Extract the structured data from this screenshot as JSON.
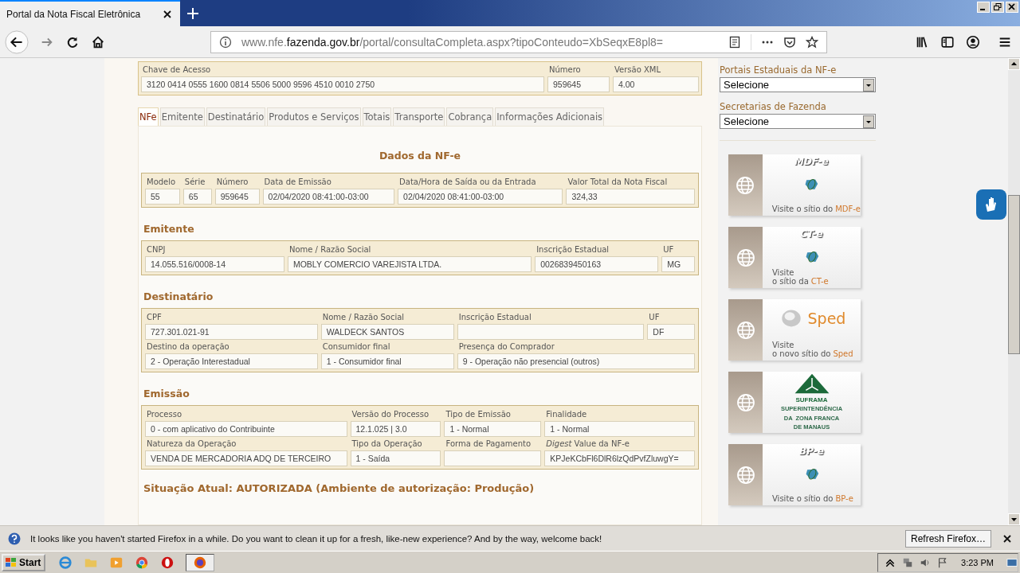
{
  "browser": {
    "tab_title": "Portal da Nota Fiscal Eletrônica",
    "url_prefix": "www.nfe.",
    "url_domain": "fazenda.gov.br",
    "url_path": "/portal/consultaCompleta.aspx?tipoConteudo=XbSeqxE8pl8="
  },
  "key_box": [
    {
      "label": "Chave de Acesso",
      "value": "3120 0414 0555 1600 0814 5506 5000 9596 4510 0010 2750"
    },
    {
      "label": "Número",
      "value": "959645"
    },
    {
      "label": "Versão XML",
      "value": "4.00"
    }
  ],
  "tabs": [
    {
      "label": "NFe",
      "selected": true
    },
    {
      "label": "Emitente",
      "selected": false
    },
    {
      "label": "Destinatário",
      "selected": false
    },
    {
      "label": "Produtos e Serviços",
      "selected": false
    },
    {
      "label": "Totais",
      "selected": false
    },
    {
      "label": "Transporte",
      "selected": false
    },
    {
      "label": "Cobrança",
      "selected": false
    },
    {
      "label": "Informações Adicionais",
      "selected": false
    }
  ],
  "panel_title": "Dados da NF-e",
  "sections": [
    {
      "rows": [
        [
          {
            "label": "Modelo",
            "value": "55"
          },
          {
            "label": "Série",
            "value": "65"
          },
          {
            "label": "Número",
            "value": "959645"
          },
          {
            "label": "Data de Emissão",
            "value": "02/04/2020 08:41:00-03:00"
          },
          {
            "label": "Data/Hora de Saída ou da Entrada",
            "value": "02/04/2020 08:41:00-03:00"
          },
          {
            "label": "Valor Total da Nota Fiscal",
            "value": "324,33"
          }
        ]
      ]
    },
    {
      "heading": "Emitente",
      "rows": [
        [
          {
            "label": "CNPJ",
            "value": "14.055.516/0008-14"
          },
          {
            "label": "Nome / Razão Social",
            "value": "MOBLY COMERCIO VAREJISTA LTDA."
          },
          {
            "label": "Inscrição Estadual",
            "value": "0026839450163"
          },
          {
            "label": "UF",
            "value": "MG"
          }
        ]
      ]
    },
    {
      "heading": "Destinatário",
      "rows": [
        [
          {
            "label": "CPF",
            "value": "727.301.021-91"
          },
          {
            "label": "Nome / Razão Social",
            "value": "WALDECK SANTOS"
          },
          {
            "label": "Inscrição Estadual"
          },
          {
            "label": "UF",
            "value": "DF"
          }
        ],
        [
          {
            "label": "Destino da operação",
            "value": "2 - Operação Interestadual"
          },
          {
            "label": "Consumidor final",
            "value": "1 - Consumidor final"
          },
          {
            "label": "Presença do Comprador",
            "value": "9 - Operação não presencial (outros)"
          }
        ]
      ]
    },
    {
      "heading": "Emissão",
      "rows": [
        [
          {
            "label": "Processo",
            "value": "0 - com aplicativo do Contribuinte"
          },
          {
            "label": "Versão do Processo",
            "value": "12.1.025 | 3.0"
          },
          {
            "label": "Tipo de Emissão",
            "value": "1 - Normal"
          },
          {
            "label": "Finalidade",
            "value": "1 - Normal"
          }
        ],
        [
          {
            "label": "Natureza da Operação",
            "value": "VENDA DE MERCADORIA ADQ DE TERCEIRO"
          },
          {
            "label": "Tipo da Operação",
            "value": "1 - Saída"
          },
          {
            "label": "Forma de Pagamento"
          },
          {
            "label": "*Digest* Value da NF-e",
            "value": "KPJeKCbFl6DlR6lzQdPvfZluwgY="
          }
        ]
      ]
    }
  ],
  "status_line": "Situação Atual: AUTORIZADA (Ambiente de autorização: Produção)",
  "sidebar": {
    "selects": [
      {
        "label": "Portais Estaduais da NF-e",
        "value": "Selecione"
      },
      {
        "label": "Secretarias de Fazenda",
        "value": "Selecione"
      }
    ],
    "banners": [
      {
        "kind": "logo",
        "logo": "MDF-e",
        "caption": [
          "Visite o sítio do"
        ],
        "highlight": "MDF-e"
      },
      {
        "kind": "logo",
        "logo": "CT-e",
        "caption": [
          "Visite",
          "o sítio da"
        ],
        "highlight": "CT-e"
      },
      {
        "kind": "wordmark",
        "logo": "Sped",
        "caption": [
          "Visite",
          "o novo sítio do"
        ],
        "highlight": "Sped"
      },
      {
        "kind": "emblem",
        "logo": "SUFRAMA",
        "subtitle": [
          "SUPERINTENDÊNCIA",
          "DA  ZONA FRANCA",
          "DE MANAUS"
        ]
      },
      {
        "kind": "logo",
        "logo": "BP-e",
        "caption": [
          "Visite o sítio do"
        ],
        "highlight": "BP-e"
      }
    ]
  },
  "notification": {
    "text": "It looks like you haven't started Firefox in a while. Do you want to clean it up for a fresh, like-new experience? And by the way, welcome back!",
    "button": "Refresh Firefox…"
  },
  "taskbar": {
    "start": "Start",
    "time": "3:23 PM"
  }
}
